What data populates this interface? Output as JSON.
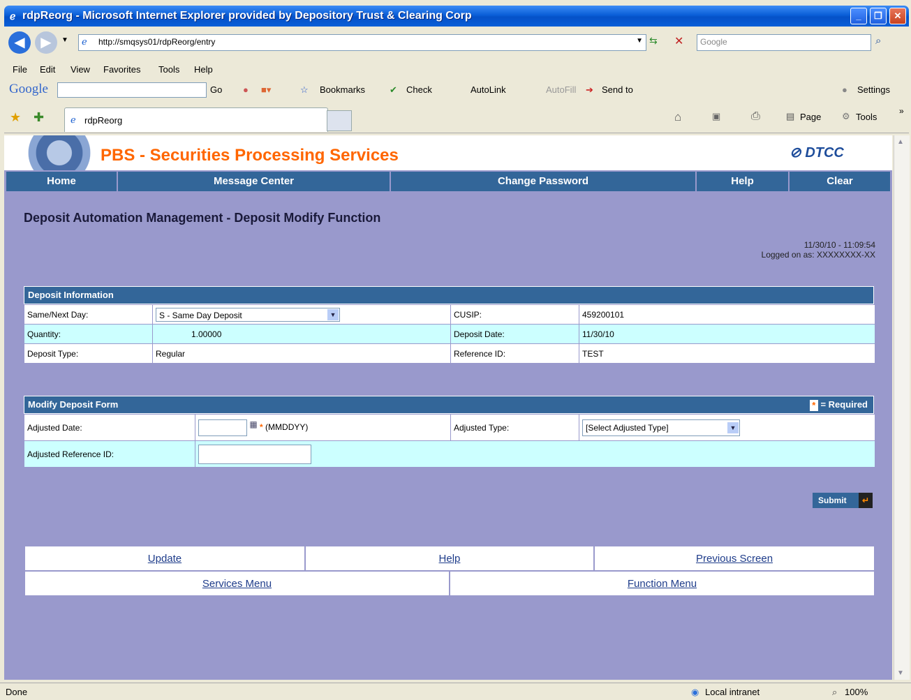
{
  "window": {
    "title": "rdpReorg - Microsoft Internet Explorer provided by Depository Trust & Clearing Corp"
  },
  "address": {
    "url": "http://smqsys01/rdpReorg/entry",
    "search_placeholder": "Google"
  },
  "menu": [
    "File",
    "Edit",
    "View",
    "Favorites",
    "Tools",
    "Help"
  ],
  "google_toolbar": {
    "logo": "Google",
    "go": "Go",
    "bookmarks": "Bookmarks",
    "check": "Check",
    "autolink": "AutoLink",
    "autofill": "AutoFill",
    "sendto": "Send to",
    "settings": "Settings"
  },
  "tab": {
    "label": "rdpReorg"
  },
  "cmdbar": {
    "page": "Page",
    "tools": "Tools"
  },
  "app": {
    "title": "PBS - Securities Processing Services",
    "brand": "DTCC"
  },
  "nav": [
    "Home",
    "Message Center",
    "Change Password",
    "Help",
    "Clear"
  ],
  "page_title": "Deposit Automation Management - Deposit Modify Function",
  "stamp": {
    "datetime": "11/30/10 - 11:09:54",
    "logged_label": "Logged on as:",
    "user": "XXXXXXXX-XX"
  },
  "deposit_info": {
    "heading": "Deposit Information",
    "same_next_label": "Same/Next Day:",
    "same_next_value": "S - Same Day Deposit",
    "cusip_label": "CUSIP:",
    "cusip_value": "459200101",
    "quantity_label": "Quantity:",
    "quantity_value": "1.00000",
    "deposit_date_label": "Deposit Date:",
    "deposit_date_value": "11/30/10",
    "deposit_type_label": "Deposit Type:",
    "deposit_type_value": "Regular",
    "reference_label": "Reference ID:",
    "reference_value": "TEST"
  },
  "modify_form": {
    "heading": "Modify Deposit Form",
    "required_note": "= Required",
    "adjusted_date_label": "Adjusted Date:",
    "date_format": "(MMDDYY)",
    "adjusted_type_label": "Adjusted Type:",
    "adjusted_type_value": "[Select Adjusted Type]",
    "adjusted_ref_label": "Adjusted Reference ID:"
  },
  "submit_label": "Submit",
  "links": {
    "update": "Update",
    "help": "Help",
    "previous": "Previous Screen",
    "services": "Services Menu",
    "function": "Function Menu"
  },
  "status": {
    "left": "Done",
    "zone": "Local intranet",
    "zoom": "100%"
  },
  "colors": {
    "nav_blue": "#336699",
    "content_bg": "#9999cc",
    "accent_orange": "#ff6600",
    "row_cyan": "#ccffff"
  }
}
